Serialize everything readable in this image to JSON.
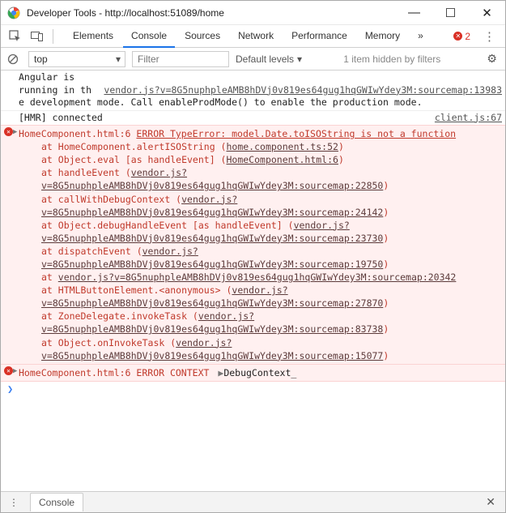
{
  "window": {
    "title": "Developer Tools - http://localhost:51089/home"
  },
  "toolbar": {
    "tabs": [
      "Elements",
      "Console",
      "Sources",
      "Network",
      "Performance",
      "Memory"
    ],
    "active_tab": "Console",
    "error_count": "2"
  },
  "filterbar": {
    "context": "top",
    "filter_placeholder": "Filter",
    "levels_label": "Default levels",
    "hidden_note": "1 item hidden by filters"
  },
  "log": {
    "line1_a": "Angular is    ",
    "line1_link": "vendor.js?v=8G5nuphpleAMB8hDVj0v819es64gug1hqGWIwYdey3M:sourcemap:13983",
    "line1_b": "running in the development mode. Call enableProdMode() to enable the production mode.",
    "hmr_text": "[HMR] connected",
    "hmr_src": "client.js:67"
  },
  "error1": {
    "src": "HomeComponent.html:6",
    "head": "ERROR TypeError: model.Date.toISOString is not a function",
    "at1_pre": "at HomeComponent.alertISOString (",
    "at1_link": "home.component.ts:52",
    "at2_pre": "at Object.eval [as handleEvent] (",
    "at2_link": "HomeComponent.html:6",
    "at3_pre": "at handleEvent (",
    "at3_link": "vendor.js?v=8G5nuphpleAMB8hDVj0v819es64gug1hqGWIwYdey3M:sourcemap:22850",
    "at4_pre": "at callWithDebugContext (",
    "at4_link": "vendor.js?v=8G5nuphpleAMB8hDVj0v819es64gug1hqGWIwYdey3M:sourcemap:24142",
    "at5_pre": "at Object.debugHandleEvent [as handleEvent] (",
    "at5_link": "vendor.js?v=8G5nuphpleAMB8hDVj0v819es64gug1hqGWIwYdey3M:sourcemap:23730",
    "at6_pre": "at dispatchEvent (",
    "at6_link": "vendor.js?v=8G5nuphpleAMB8hDVj0v819es64gug1hqGWIwYdey3M:sourcemap:19750",
    "at7_pre": "at ",
    "at7_link": "vendor.js?v=8G5nuphpleAMB8hDVj0v819es64gug1hqGWIwYdey3M:sourcemap:20342",
    "at8_pre": "at HTMLButtonElement.<anonymous> (",
    "at8_link": "vendor.js?v=8G5nuphpleAMB8hDVj0v819es64gug1hqGWIwYdey3M:sourcemap:27870",
    "at9_pre": "at ZoneDelegate.invokeTask (",
    "at9_link": "vendor.js?v=8G5nuphpleAMB8hDVj0v819es64gug1hqGWIwYdey3M:sourcemap:83738",
    "at10_pre": "at Object.onInvokeTask (",
    "at10_link": "vendor.js?v=8G5nuphpleAMB8hDVj0v819es64gug1hqGWIwYdey3M:sourcemap:15077"
  },
  "error2": {
    "src": "HomeComponent.html:6",
    "label": "ERROR CONTEXT",
    "object": "DebugContext_"
  },
  "drawer": {
    "tab": "Console"
  }
}
